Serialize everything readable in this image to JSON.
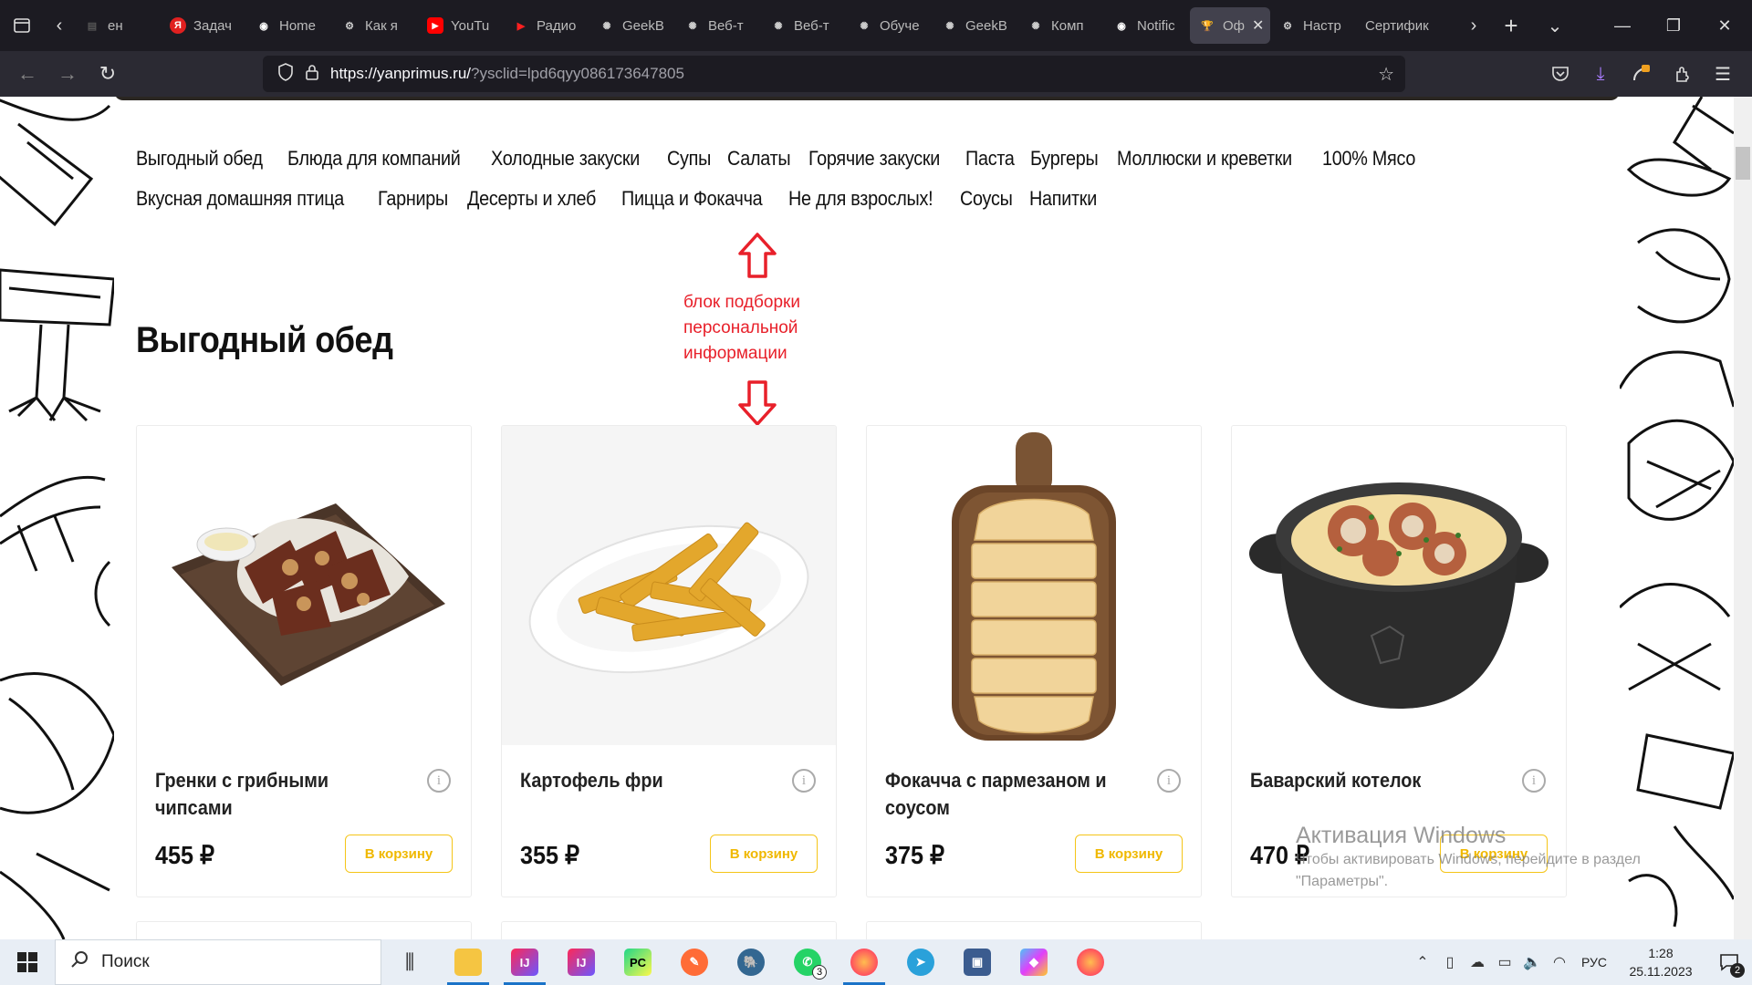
{
  "browser": {
    "tabs": [
      {
        "label": "ен",
        "icon": "article-icon",
        "color": "#555555"
      },
      {
        "label": "Задач",
        "icon": "yandex-icon",
        "color": "#e02020"
      },
      {
        "label": "Home",
        "icon": "github-icon",
        "color": "#ffffff"
      },
      {
        "label": "Как я",
        "icon": "gear-icon",
        "color": "#cccccc"
      },
      {
        "label": "YouTu",
        "icon": "youtube-icon",
        "color": "#ff0000"
      },
      {
        "label": "Радио",
        "icon": "play-icon",
        "color": "#ff2020"
      },
      {
        "label": "GeekB",
        "icon": "openai-icon",
        "color": "#cccccc"
      },
      {
        "label": "Веб-т",
        "icon": "openai-icon",
        "color": "#cccccc"
      },
      {
        "label": "Веб-т",
        "icon": "openai-icon",
        "color": "#cccccc"
      },
      {
        "label": "Обуче",
        "icon": "openai-icon",
        "color": "#cccccc"
      },
      {
        "label": "GeekB",
        "icon": "openai-icon",
        "color": "#cccccc"
      },
      {
        "label": "Комп",
        "icon": "openai-icon",
        "color": "#cccccc"
      },
      {
        "label": "Notific",
        "icon": "github-icon",
        "color": "#ffffff"
      },
      {
        "label": "Оф",
        "icon": "trophy-icon",
        "color": "#f5c518",
        "active": true
      },
      {
        "label": "Настр",
        "icon": "gear-icon",
        "color": "#cccccc"
      },
      {
        "label": "Сертифик",
        "icon": "none",
        "color": "#cccccc"
      }
    ],
    "url": {
      "host": "https://yanprimus.ru/",
      "path": "?ysclid=lpd6qyy086173647805"
    }
  },
  "menu": {
    "row1": [
      "Выгодный обед",
      "Блюда для компаний",
      "Холодные закуски",
      "Супы",
      "Салаты",
      "Горячие закуски",
      "Паста",
      "Бургеры",
      "Моллюски и креветки",
      "100% Мясо"
    ],
    "row2": [
      "Вкусная домашняя птица",
      "Гарниры",
      "Десерты и хлеб",
      "Пицца и Фокачча",
      "Не для взрослых!",
      "Соусы",
      "Напитки"
    ]
  },
  "annotation": {
    "text": "блок подборки персональной информации",
    "color": "#e8202a"
  },
  "section": {
    "title": "Выгодный обед"
  },
  "products": [
    {
      "name": "Гренки с грибными чипсами",
      "price": "455 ₽",
      "button": "В корзину",
      "image": "croutons-image"
    },
    {
      "name": "Картофель фри",
      "price": "355 ₽",
      "button": "В корзину",
      "image": "fries-image"
    },
    {
      "name": "Фокачча с пармезаном и соусом",
      "price": "375 ₽",
      "button": "В корзину",
      "image": "focaccia-image"
    },
    {
      "name": "Баварский котелок",
      "price": "470 ₽",
      "button": "В корзину",
      "image": "pot-image"
    }
  ],
  "watermark": {
    "title": "Активация Windows",
    "line1": "Чтобы активировать Windows, перейдите в раздел",
    "line2": "\"Параметры\"."
  },
  "taskbar": {
    "search_placeholder": "Поиск",
    "lang": "РУС",
    "time": "1:28",
    "date": "25.11.2023",
    "notifications": "2",
    "whatsapp_badge": "3"
  },
  "accent": "#f5c518"
}
